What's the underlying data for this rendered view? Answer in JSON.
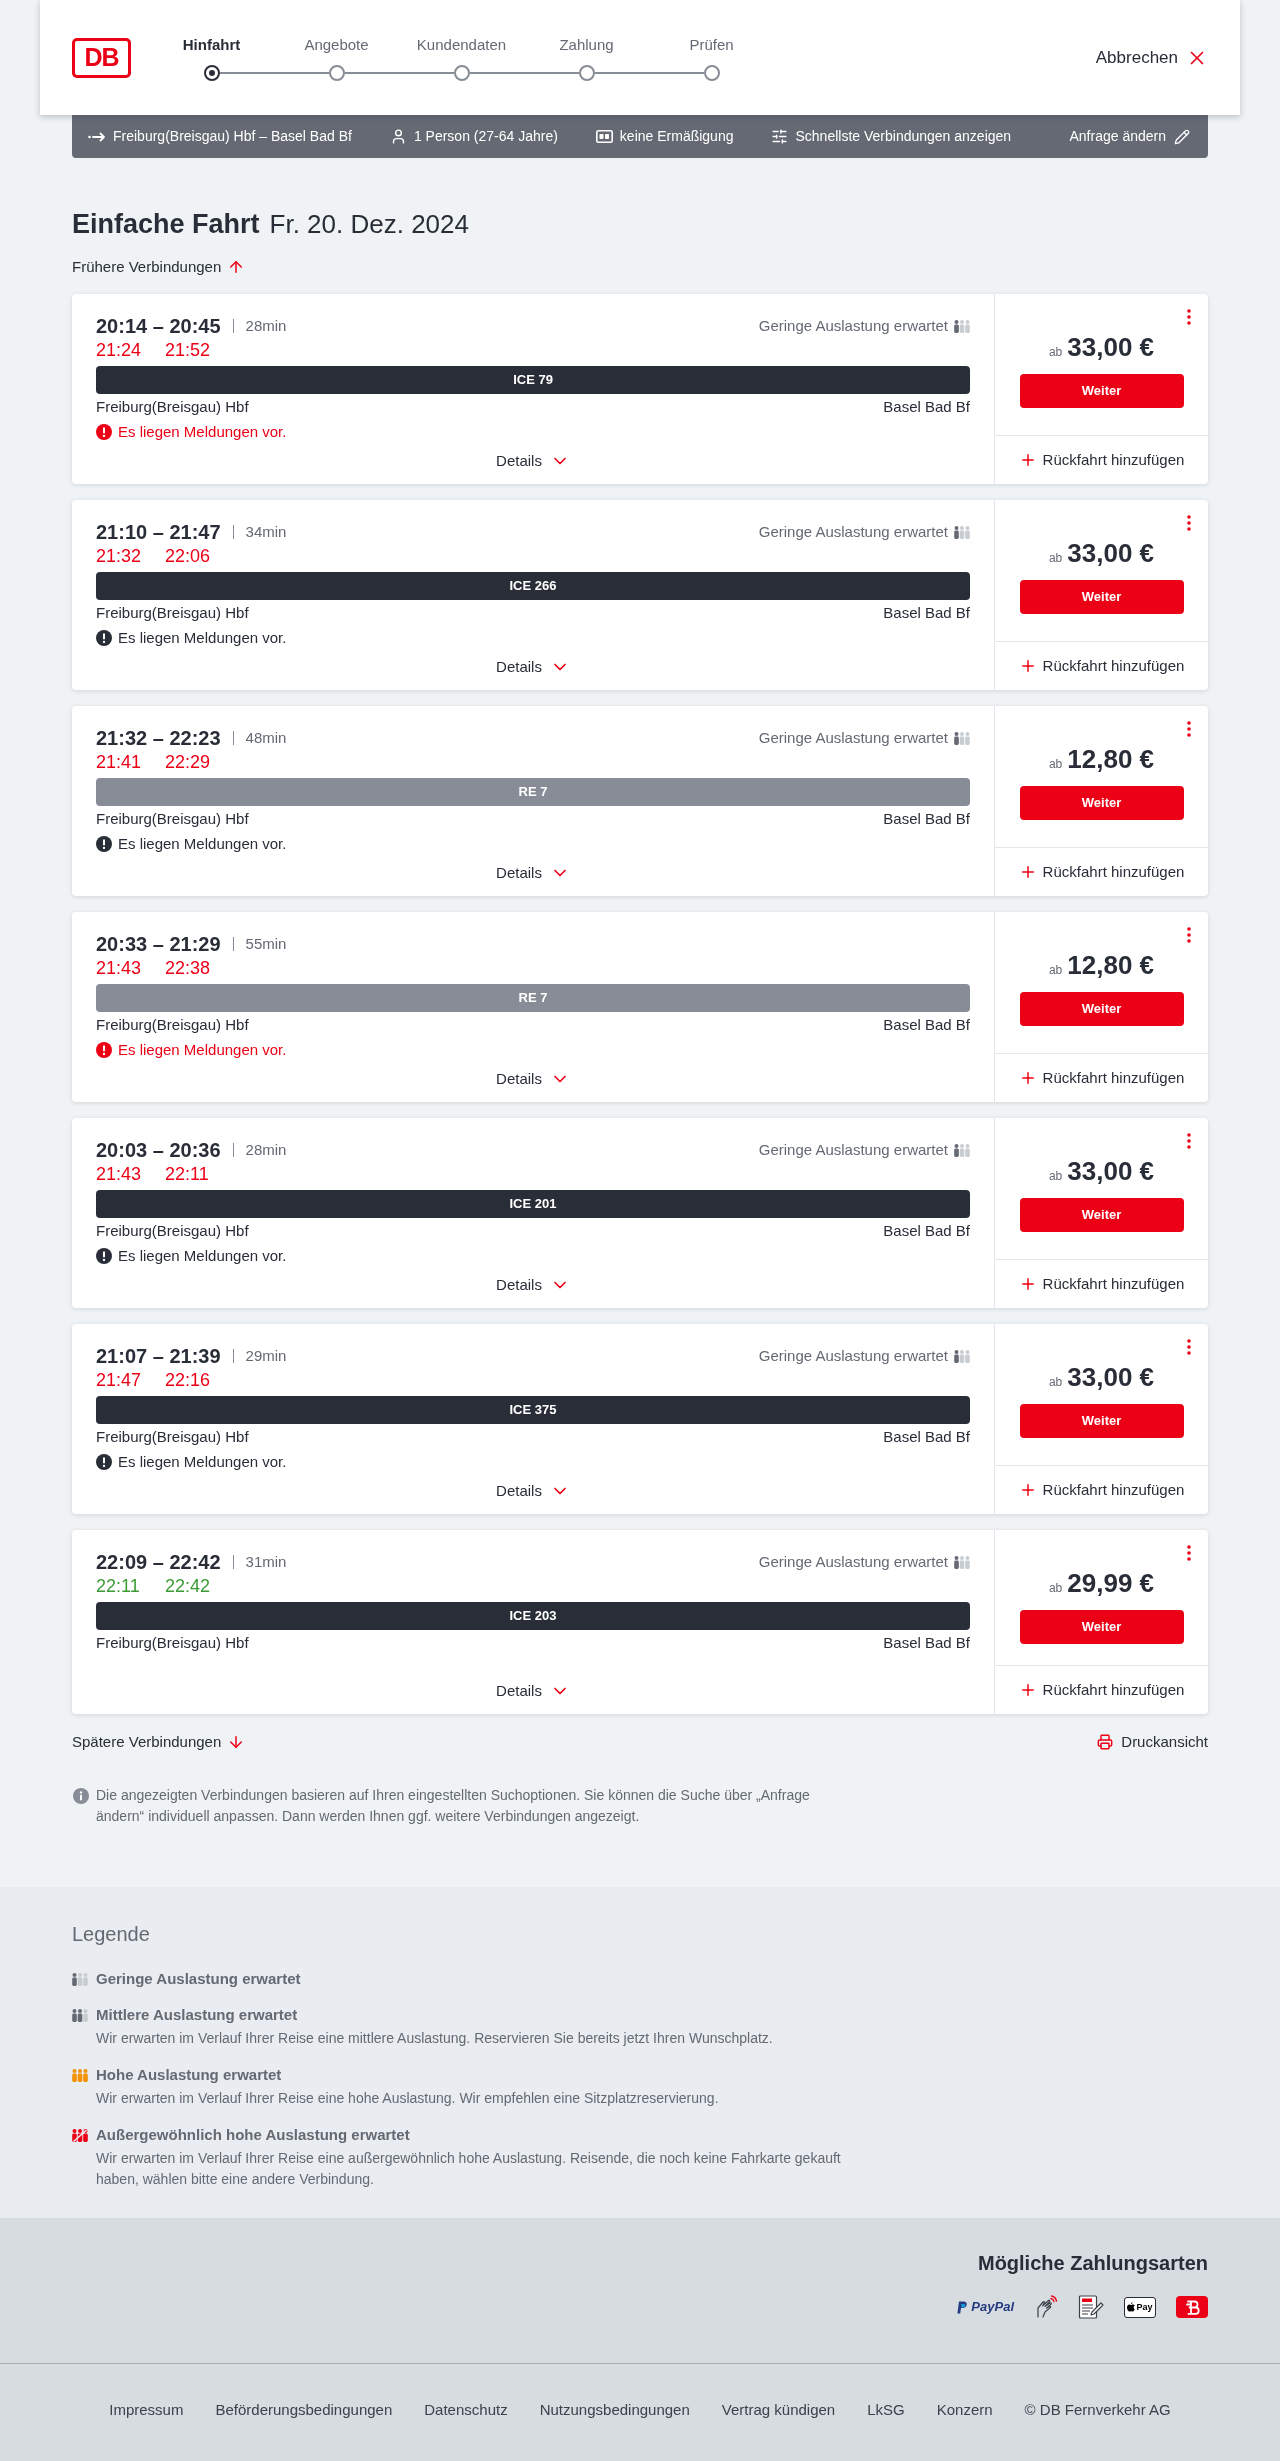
{
  "header": {
    "logo": "DB",
    "steps": [
      {
        "label": "Hinfahrt",
        "selected": true
      },
      {
        "label": "Angebote",
        "selected": false
      },
      {
        "label": "Kundendaten",
        "selected": false
      },
      {
        "label": "Zahlung",
        "selected": false
      },
      {
        "label": "Prüfen",
        "selected": false
      }
    ],
    "cancel": "Abbrechen"
  },
  "search_summary": {
    "items": [
      {
        "kind": "route",
        "label": "Freiburg(Breisgau) Hbf – Basel Bad Bf"
      },
      {
        "kind": "travelers",
        "label": "1 Person (27-64 Jahre)"
      },
      {
        "kind": "discount",
        "label": "keine Ermäßigung"
      },
      {
        "kind": "filter",
        "label": "Schnellste Verbindungen anzeigen"
      }
    ],
    "edit": "Anfrage ändern"
  },
  "title": {
    "trip_type": "Einfache Fahrt",
    "date": "Fr. 20. Dez. 2024"
  },
  "earlier": "Frühere Verbindungen",
  "connections": [
    {
      "times": "20:14 – 20:45",
      "duration": "28min",
      "delayed": true,
      "rt_departure": "21:24",
      "rt_arrival": "21:52",
      "occupancy": {
        "kind": "low",
        "label": "Geringe Auslastung erwartet"
      },
      "train": {
        "kind": "long_distance",
        "label": "ICE 79"
      },
      "from": "Freiburg(Breisgau) Hbf",
      "to": "Basel Bad Bf",
      "notice": {
        "kind": "warning",
        "label": "Es liegen Meldungen vor."
      },
      "details": "Details",
      "price_prefix": "ab",
      "price": "33,00 €",
      "continue": "Weiter",
      "add_return": "Rückfahrt hinzufügen"
    },
    {
      "times": "21:10 – 21:47",
      "duration": "34min",
      "delayed": true,
      "rt_departure": "21:32",
      "rt_arrival": "22:06",
      "occupancy": {
        "kind": "low",
        "label": "Geringe Auslastung erwartet"
      },
      "train": {
        "kind": "long_distance",
        "label": "ICE 266"
      },
      "from": "Freiburg(Breisgau) Hbf",
      "to": "Basel Bad Bf",
      "notice": {
        "kind": "info",
        "label": "Es liegen Meldungen vor."
      },
      "details": "Details",
      "price_prefix": "ab",
      "price": "33,00 €",
      "continue": "Weiter",
      "add_return": "Rückfahrt hinzufügen"
    },
    {
      "times": "21:32 – 22:23",
      "duration": "48min",
      "delayed": true,
      "rt_departure": "21:41",
      "rt_arrival": "22:29",
      "occupancy": {
        "kind": "low",
        "label": "Geringe Auslastung erwartet"
      },
      "train": {
        "kind": "regional",
        "label": "RE 7"
      },
      "from": "Freiburg(Breisgau) Hbf",
      "to": "Basel Bad Bf",
      "notice": {
        "kind": "info",
        "label": "Es liegen Meldungen vor."
      },
      "details": "Details",
      "price_prefix": "ab",
      "price": "12,80 €",
      "continue": "Weiter",
      "add_return": "Rückfahrt hinzufügen"
    },
    {
      "times": "20:33 – 21:29",
      "duration": "55min",
      "delayed": true,
      "rt_departure": "21:43",
      "rt_arrival": "22:38",
      "train": {
        "kind": "regional",
        "label": "RE 7"
      },
      "from": "Freiburg(Breisgau) Hbf",
      "to": "Basel Bad Bf",
      "notice": {
        "kind": "warning",
        "label": "Es liegen Meldungen vor."
      },
      "details": "Details",
      "price_prefix": "ab",
      "price": "12,80 €",
      "continue": "Weiter",
      "add_return": "Rückfahrt hinzufügen"
    },
    {
      "times": "20:03 – 20:36",
      "duration": "28min",
      "delayed": true,
      "rt_departure": "21:43",
      "rt_arrival": "22:11",
      "occupancy": {
        "kind": "low",
        "label": "Geringe Auslastung erwartet"
      },
      "train": {
        "kind": "long_distance",
        "label": "ICE 201"
      },
      "from": "Freiburg(Breisgau) Hbf",
      "to": "Basel Bad Bf",
      "notice": {
        "kind": "info",
        "label": "Es liegen Meldungen vor."
      },
      "details": "Details",
      "price_prefix": "ab",
      "price": "33,00 €",
      "continue": "Weiter",
      "add_return": "Rückfahrt hinzufügen"
    },
    {
      "times": "21:07 – 21:39",
      "duration": "29min",
      "delayed": true,
      "rt_departure": "21:47",
      "rt_arrival": "22:16",
      "occupancy": {
        "kind": "low",
        "label": "Geringe Auslastung erwartet"
      },
      "train": {
        "kind": "long_distance",
        "label": "ICE 375"
      },
      "from": "Freiburg(Breisgau) Hbf",
      "to": "Basel Bad Bf",
      "notice": {
        "kind": "info",
        "label": "Es liegen Meldungen vor."
      },
      "details": "Details",
      "price_prefix": "ab",
      "price": "33,00 €",
      "continue": "Weiter",
      "add_return": "Rückfahrt hinzufügen"
    },
    {
      "times": "22:09 – 22:42",
      "duration": "31min",
      "delayed": false,
      "rt_departure": "22:11",
      "rt_arrival": "22:42",
      "occupancy": {
        "kind": "low",
        "label": "Geringe Auslastung erwartet"
      },
      "train": {
        "kind": "long_distance",
        "label": "ICE 203"
      },
      "from": "Freiburg(Breisgau) Hbf",
      "to": "Basel Bad Bf",
      "details": "Details",
      "price_prefix": "ab",
      "price": "29,99 €",
      "continue": "Weiter",
      "add_return": "Rückfahrt hinzufügen"
    }
  ],
  "later": "Spätere Verbindungen",
  "print": "Druckansicht",
  "info": "Die angezeigten Verbindungen basieren auf Ihren eingestellten Suchoptionen. Sie können die Suche über „Anfrage ändern“ individuell anpassen. Dann werden Ihnen ggf. weitere Verbindungen angezeigt.",
  "legend": {
    "title": "Legende",
    "items": [
      {
        "kind": "low",
        "title": "Geringe Auslastung erwartet"
      },
      {
        "kind": "medium",
        "title": "Mittlere Auslastung erwartet",
        "description": "Wir erwarten im Verlauf Ihrer Reise eine mittlere Auslastung. Reservieren Sie bereits jetzt Ihren Wunschplatz."
      },
      {
        "kind": "high",
        "title": "Hohe Auslastung erwartet",
        "description": "Wir erwarten im Verlauf Ihrer Reise eine hohe Auslastung. Wir empfehlen eine Sitzplatzreservierung."
      },
      {
        "kind": "exceptional",
        "title": "Außergewöhnlich hohe Auslastung erwartet",
        "description": "Wir erwarten im Verlauf Ihrer Reise eine außergewöhnlich hohe Auslastung. Reisende, die noch keine Fahrkarte gekauft haben, wählen bitte eine andere Verbindung."
      }
    ]
  },
  "footer": {
    "payment_title": "Mögliche Zahlungsarten",
    "payment_methods": [
      {
        "kind": "paypal",
        "label": "PayPal"
      },
      {
        "kind": "contactless"
      },
      {
        "kind": "sepa"
      },
      {
        "kind": "applepay",
        "label": "Pay"
      },
      {
        "kind": "bonus"
      }
    ],
    "links": [
      "Impressum",
      "Beförderungsbedingungen",
      "Datenschutz",
      "Nutzungsbedingungen",
      "Vertrag kündigen",
      "LkSG",
      "Konzern"
    ],
    "copyright": "© DB Fernverkehr AG"
  }
}
